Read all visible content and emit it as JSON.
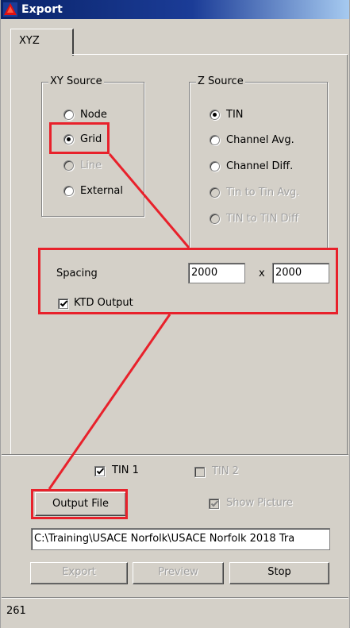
{
  "window": {
    "title": "Export"
  },
  "tabs": [
    {
      "label": "XYZ"
    }
  ],
  "xy_source": {
    "legend": "XY Source",
    "options": [
      {
        "label": "Node",
        "checked": false,
        "enabled": true
      },
      {
        "label": "Grid",
        "checked": true,
        "enabled": true
      },
      {
        "label": "Line",
        "checked": false,
        "enabled": false
      },
      {
        "label": "External",
        "checked": false,
        "enabled": true
      }
    ]
  },
  "z_source": {
    "legend": "Z Source",
    "options": [
      {
        "label": "TIN",
        "checked": true,
        "enabled": true
      },
      {
        "label": "Channel Avg.",
        "checked": false,
        "enabled": true
      },
      {
        "label": "Channel Diff.",
        "checked": false,
        "enabled": true
      },
      {
        "label": "Tin to Tin Avg.",
        "checked": false,
        "enabled": false
      },
      {
        "label": "TIN to TIN Diff",
        "checked": false,
        "enabled": false
      }
    ]
  },
  "spacing": {
    "label": "Spacing",
    "x_value": "2000",
    "separator": "x",
    "y_value": "2000"
  },
  "ktd_output": {
    "label": "KTD Output",
    "checked": true
  },
  "tin1": {
    "label": "TIN 1",
    "checked": true,
    "enabled": true
  },
  "tin2": {
    "label": "TIN 2",
    "checked": false,
    "enabled": false
  },
  "output_file_label": "Output File",
  "show_picture": {
    "label": "Show Picture",
    "checked": true,
    "enabled": false
  },
  "output_path": "C:\\Training\\USACE Norfolk\\USACE Norfolk 2018 Tra",
  "buttons": {
    "export": "Export",
    "preview": "Preview",
    "stop": "Stop"
  },
  "status": {
    "text": "261"
  },
  "colors": {
    "annotation": "#e8212b",
    "titlebar": "#0a246a",
    "dialog": "#d4d0c8"
  }
}
